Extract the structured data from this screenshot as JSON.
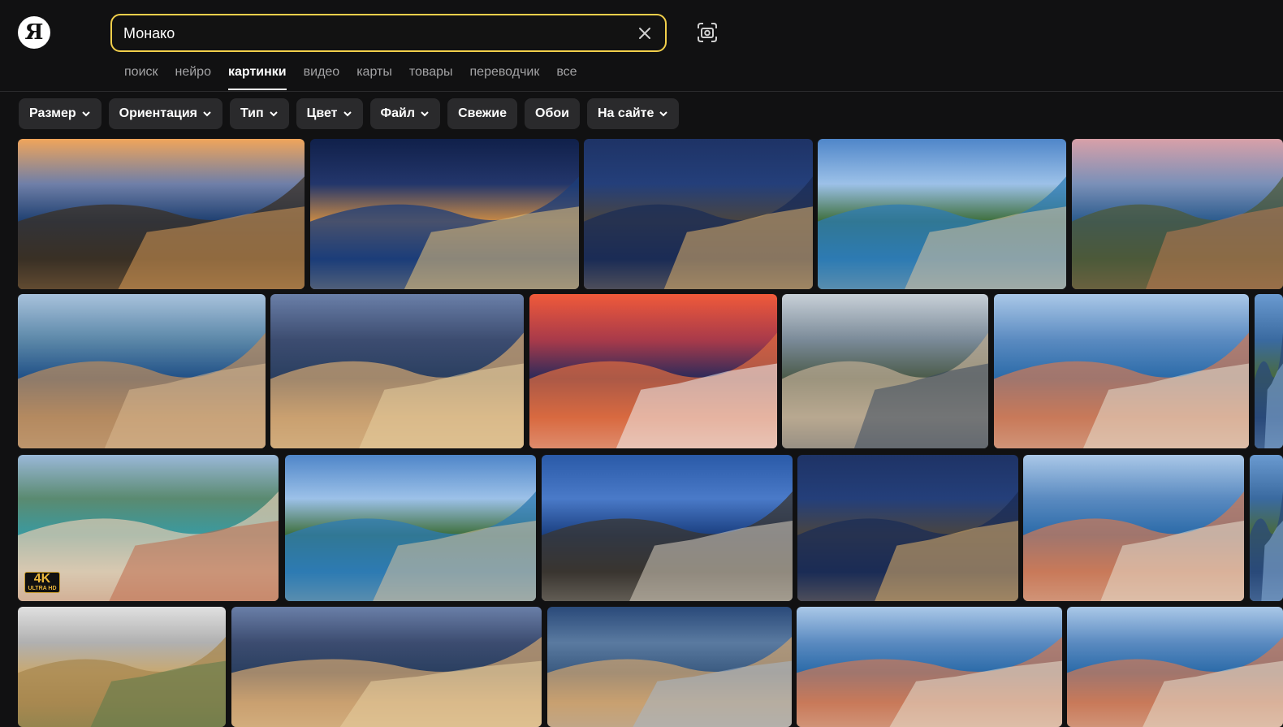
{
  "logo": {
    "letter": "Я"
  },
  "search": {
    "value": "Монако"
  },
  "tabs": [
    {
      "label": "поиск",
      "active": false
    },
    {
      "label": "нейро",
      "active": false
    },
    {
      "label": "картинки",
      "active": true
    },
    {
      "label": "видео",
      "active": false
    },
    {
      "label": "карты",
      "active": false
    },
    {
      "label": "товары",
      "active": false
    },
    {
      "label": "переводчик",
      "active": false
    },
    {
      "label": "все",
      "active": false
    }
  ],
  "filters": [
    {
      "label": "Размер",
      "dropdown": true
    },
    {
      "label": "Ориентация",
      "dropdown": true
    },
    {
      "label": "Тип",
      "dropdown": true
    },
    {
      "label": "Цвет",
      "dropdown": true
    },
    {
      "label": "Файл",
      "dropdown": true
    },
    {
      "label": "Свежие",
      "dropdown": false
    },
    {
      "label": "Обои",
      "dropdown": false
    },
    {
      "label": "На сайте",
      "dropdown": true
    }
  ],
  "results": [
    {
      "scene": "sunset-coast",
      "badge": ""
    },
    {
      "scene": "night-harbor",
      "badge": ""
    },
    {
      "scene": "night-city",
      "badge": ""
    },
    {
      "scene": "day-rock",
      "badge": ""
    },
    {
      "scene": "dusk-coast",
      "badge": ""
    },
    {
      "scene": "day-bay",
      "badge": ""
    },
    {
      "scene": "evening-harbor",
      "badge": ""
    },
    {
      "scene": "red-sunset-harbor",
      "badge": ""
    },
    {
      "scene": "cloudy-harbor",
      "badge": ""
    },
    {
      "scene": "day-harbor",
      "badge": ""
    },
    {
      "scene": "day-edge",
      "badge": ""
    },
    {
      "scene": "day-harbor-aerial",
      "badge": "4K ULTRA HD"
    },
    {
      "scene": "day-rock",
      "badge": ""
    },
    {
      "scene": "blue-coast",
      "badge": ""
    },
    {
      "scene": "night-city",
      "badge": ""
    },
    {
      "scene": "day-harbor",
      "badge": ""
    },
    {
      "scene": "day-edge",
      "badge": ""
    },
    {
      "scene": "casino",
      "badge": ""
    },
    {
      "scene": "evening-harbor",
      "badge": ""
    },
    {
      "scene": "blue-harbor",
      "badge": ""
    },
    {
      "scene": "day-harbor",
      "badge": ""
    },
    {
      "scene": "day-harbor",
      "badge": ""
    }
  ],
  "colors": {
    "accent": "#f2cf4b",
    "background": "#111112",
    "chip": "#2a2a2c"
  }
}
